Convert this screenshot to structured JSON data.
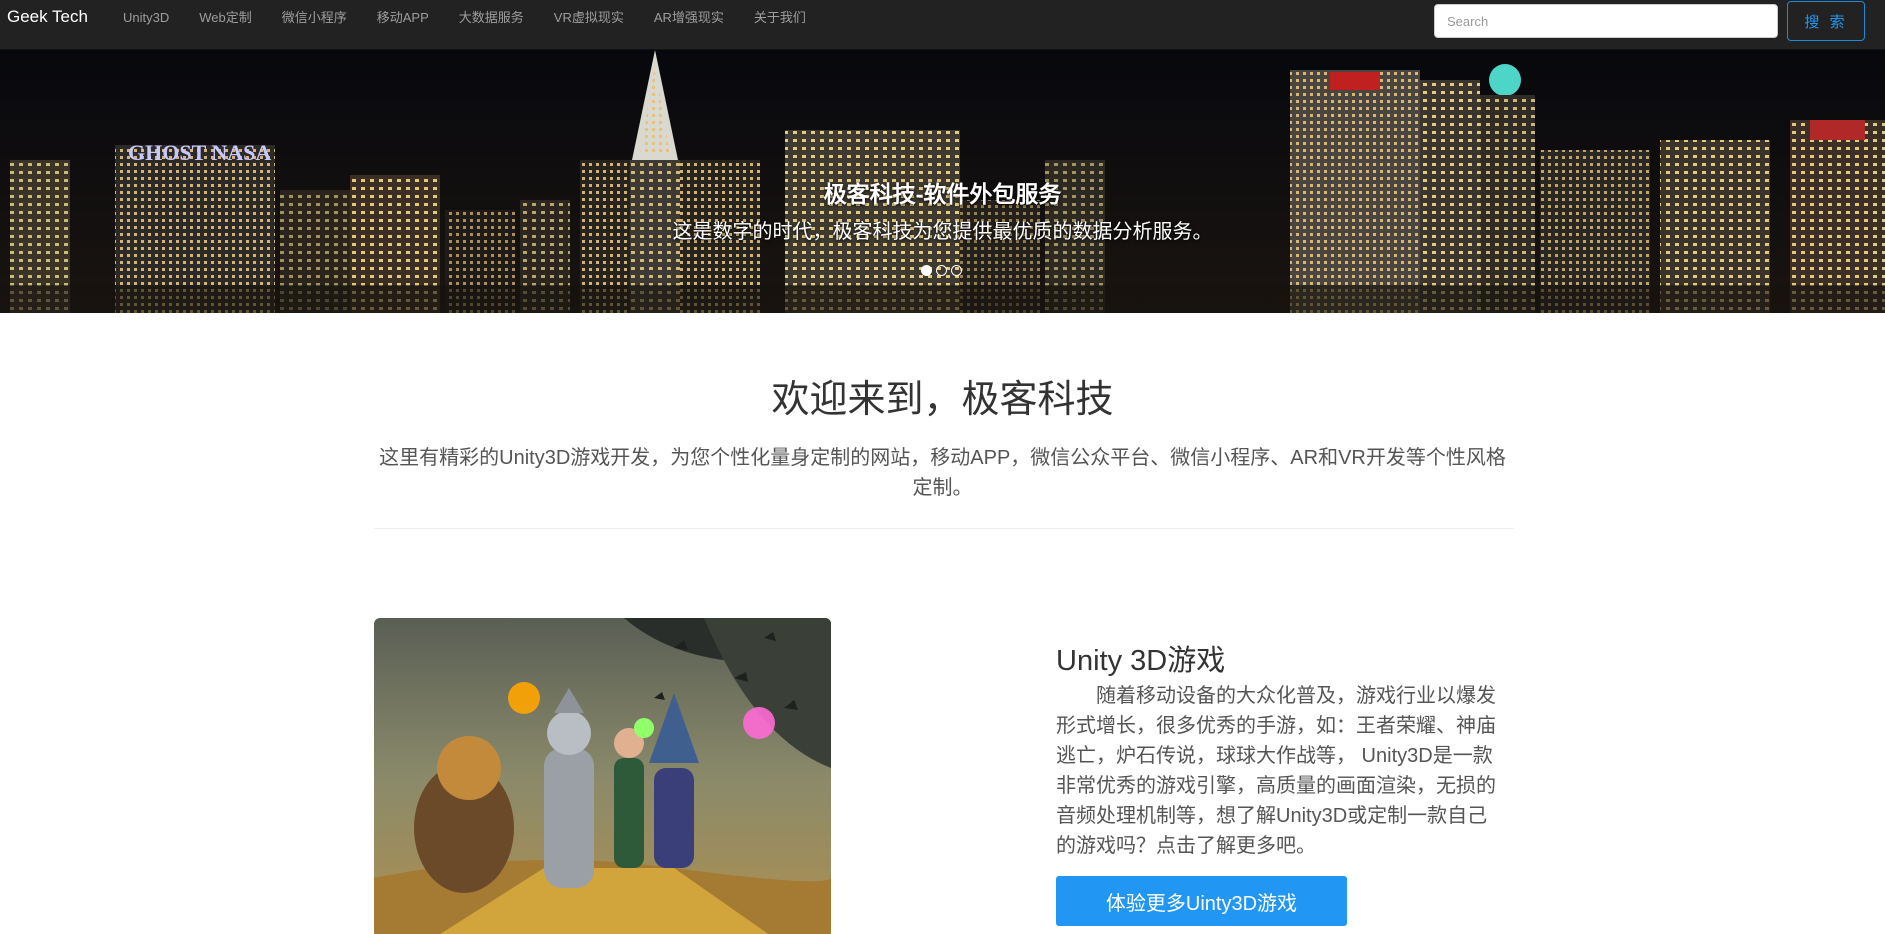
{
  "navbar": {
    "brand": "Geek Tech",
    "items": [
      {
        "label": "Unity3D"
      },
      {
        "label": "Web定制"
      },
      {
        "label": "微信小程序"
      },
      {
        "label": "移动APP"
      },
      {
        "label": "大数据服务"
      },
      {
        "label": "VR虚拟现实"
      },
      {
        "label": "AR增强现实"
      },
      {
        "label": "关于我们"
      }
    ],
    "search_placeholder": "Search",
    "search_button": "搜 索"
  },
  "carousel": {
    "title": "极客科技-软件外包服务",
    "text": "这是数字的时代，极客科技为您提供最优质的数据分析服务。",
    "slide_count": 3,
    "active_slide": 1,
    "sign_left": "GHOST NASA"
  },
  "welcome": {
    "title": "欢迎来到，极客科技",
    "description": "这里有精彩的Unity3D游戏开发，为您个性化量身定制的网站，移动APP，微信公众平台、微信小程序、AR和VR开发等个性风格定制。"
  },
  "feature": {
    "title": "Unity 3D游戏",
    "text": "随着移动设备的大众化普及，游戏行业以爆发形式增长，很多优秀的手游，如：王者荣耀、神庙逃亡，炉石传说，球球大作战等， Unity3D是一款非常优秀的游戏引擎，高质量的画面渲染，无损的音频处理机制等，想了解Unity3D或定制一款自己的游戏吗？点击了解更多吧。",
    "button": "体验更多Uinty3D游戏"
  },
  "colors": {
    "navbar_bg": "#222222",
    "accent": "#2196f3"
  }
}
